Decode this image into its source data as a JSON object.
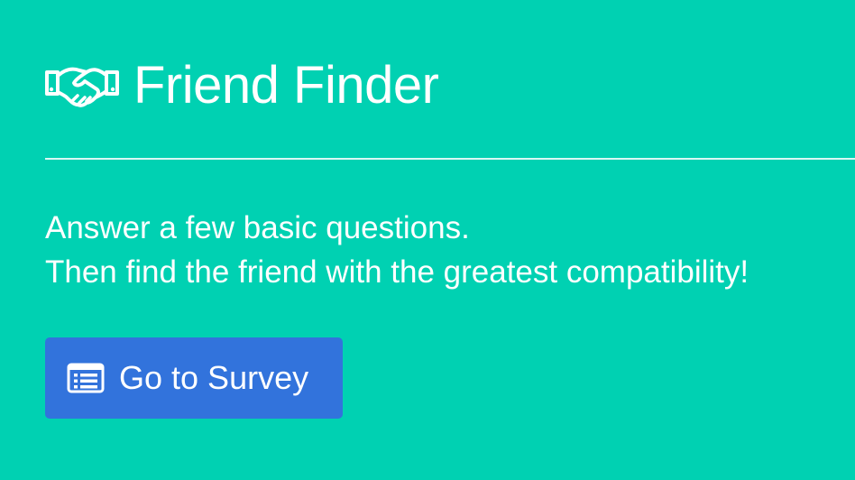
{
  "header": {
    "title": "Friend Finder",
    "icon": "handshake-icon"
  },
  "intro": {
    "line1": "Answer a few basic questions.",
    "line2": "Then find the friend with the greatest compatibility!"
  },
  "cta": {
    "label": "Go to Survey",
    "icon": "list-alt-icon"
  },
  "colors": {
    "background": "#00d1b2",
    "button": "#3273dc",
    "text": "#ffffff"
  }
}
